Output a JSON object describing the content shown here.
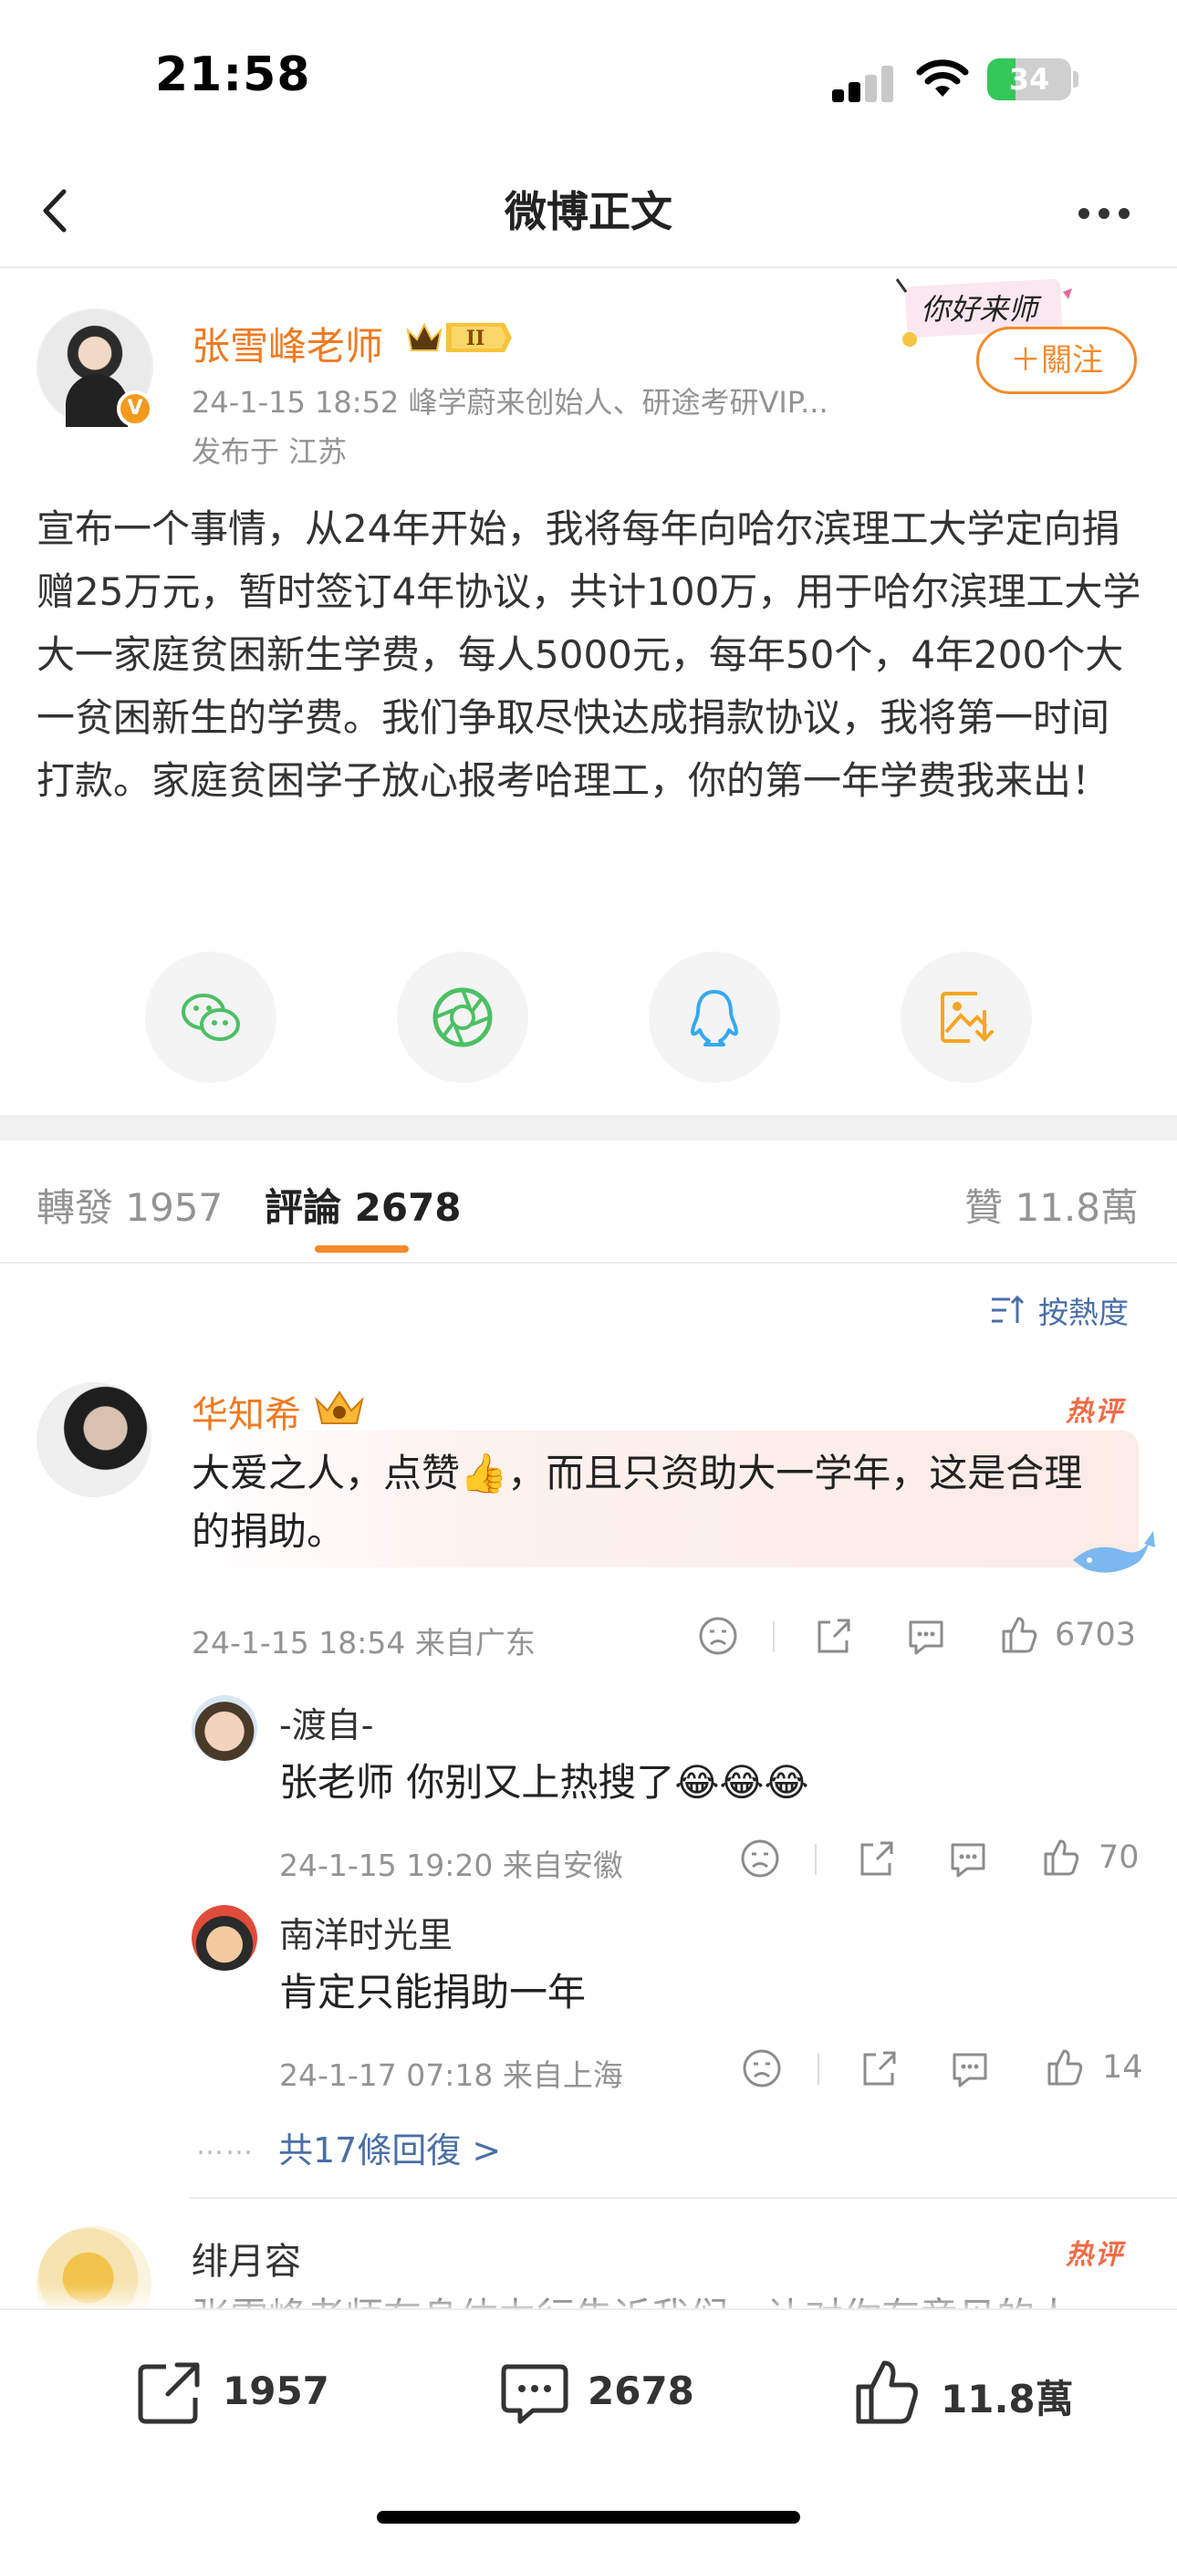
{
  "status_bar": {
    "time": "21:58",
    "battery": "34",
    "battery_level": 0.34
  },
  "nav": {
    "title": "微博正文"
  },
  "post": {
    "author": "张雪峰老师",
    "sticker_text": "你好来师",
    "follow_label": "＋關注",
    "meta": "24-1-15 18:52  峰学蔚来创始人、研途考研VIP...",
    "location": "发布于 江苏",
    "text": "宣布一个事情，从24年开始，我将每年向哈尔滨理工大学定向捐赠25万元，暂时签订4年协议，共计100万，用于哈尔滨理工大学大一家庭贫困新生学费，每人5000元，每年50个，4年200个大一贫困新生的学费。我们争取尽快达成捐款协议，我将第一时间打款。家庭贫困学子放心报考哈理工，你的第一年学费我来出！"
  },
  "share_targets": [
    {
      "icon": "wechat-icon",
      "color": "#4cc064"
    },
    {
      "icon": "moments-icon",
      "color": "#4cc064"
    },
    {
      "icon": "qq-icon",
      "color": "#35a9f0"
    },
    {
      "icon": "save-image-icon",
      "color": "#f5a623"
    }
  ],
  "tabs": {
    "repost": "轉發 1957",
    "comments_label": "評論",
    "comments_count": "2678",
    "likes": "贊 11.8萬"
  },
  "sort_label": "按熱度",
  "comments": [
    {
      "name": "华知希",
      "hot_tag": "热评",
      "text": "大爱之人，点赞👍，而且只资助大一学年，这是合理的捐助。",
      "meta": "24-1-15 18:54  来自广东",
      "likes": "6703",
      "replies": [
        {
          "name": "-渡自-",
          "text": "张老师 你别又上热搜了😂😂😂",
          "meta": "24-1-15 19:20  来自安徽",
          "likes": "70"
        },
        {
          "name": "南洋时光里",
          "text": "肯定只能捐助一年",
          "meta": "24-1-17 07:18  来自上海",
          "likes": "14"
        }
      ],
      "more_replies": "共17條回復 >"
    },
    {
      "name": "绯月容",
      "hot_tag": "热评",
      "text": "张雪峰老师在身体力行告诉我们，让对你有意见的人"
    }
  ],
  "bottom_bar": {
    "repost": "1957",
    "comment": "2678",
    "like": "11.8萬"
  }
}
